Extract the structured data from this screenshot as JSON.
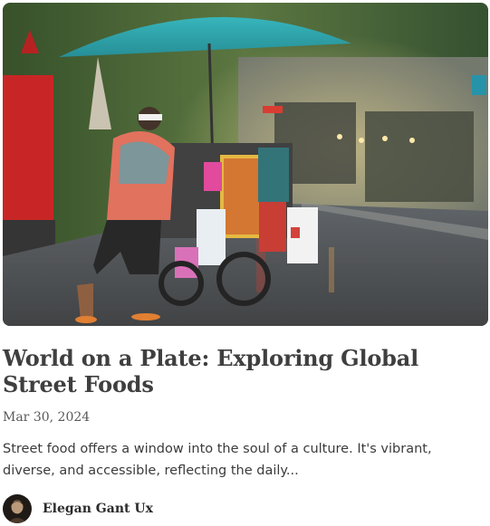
{
  "post": {
    "title": "World on a Plate: Exploring Global Street Foods",
    "date": "Mar 30, 2024",
    "excerpt": "Street food offers a window into the soul of a culture. It's vibrant, diverse, and accessible, reflecting the daily...",
    "hero_image": "street-food-vendor-cart-umbrella-rainy-street",
    "author": {
      "name": "Elegan Gant Ux",
      "avatar_icon": "portrait-avatar"
    }
  },
  "colors": {
    "title": "#3f3f3f",
    "meta": "#595959",
    "body_text": "#3b3b3b",
    "umbrella": "#2aa0a8"
  }
}
